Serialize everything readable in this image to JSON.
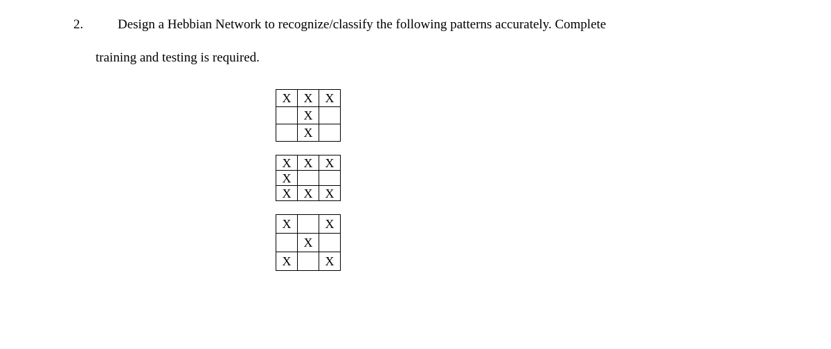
{
  "question": {
    "number": "2.",
    "line1": "Design a Hebbian Network to recognize/classify the following patterns accurately. Complete",
    "line2": "training and testing is required."
  },
  "patterns": [
    {
      "cells": [
        [
          "X",
          "X",
          "X"
        ],
        [
          "",
          "X",
          ""
        ],
        [
          "",
          "X",
          ""
        ]
      ]
    },
    {
      "cells": [
        [
          "X",
          "X",
          "X"
        ],
        [
          "X",
          "",
          ""
        ],
        [
          "X",
          "X",
          "X"
        ]
      ]
    },
    {
      "cells": [
        [
          "X",
          "",
          "X"
        ],
        [
          "",
          "X",
          ""
        ],
        [
          "X",
          "",
          "X"
        ]
      ]
    }
  ]
}
